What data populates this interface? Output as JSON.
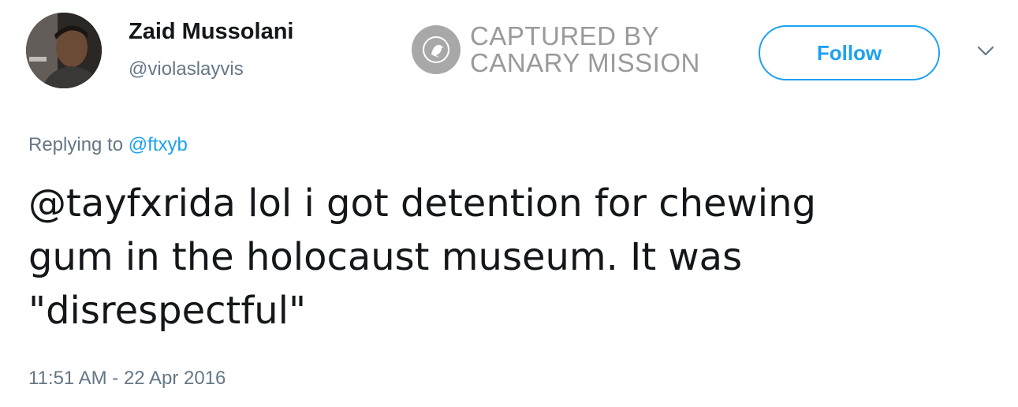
{
  "user": {
    "display_name": "Zaid Mussolani",
    "handle": "@violaslayvis"
  },
  "watermark": {
    "line1": "CAPTURED BY",
    "line2": "CANARY MISSION",
    "logo_icon": "canary-bird-icon"
  },
  "actions": {
    "follow_label": "Follow",
    "more_icon": "chevron-down-icon"
  },
  "reply": {
    "prefix": "Replying to",
    "mention": "@ftxyb"
  },
  "tweet": {
    "lines": [
      "@tayfxrida lol i got detention for chewing",
      "gum in the holocaust museum. It was",
      "\"disrespectful\""
    ],
    "timestamp": "11:51 AM - 22 Apr 2016"
  },
  "colors": {
    "accent": "#1da1f2",
    "secondary_text": "#657786",
    "primary_text": "#14171a",
    "watermark": "#9a9a9a"
  }
}
